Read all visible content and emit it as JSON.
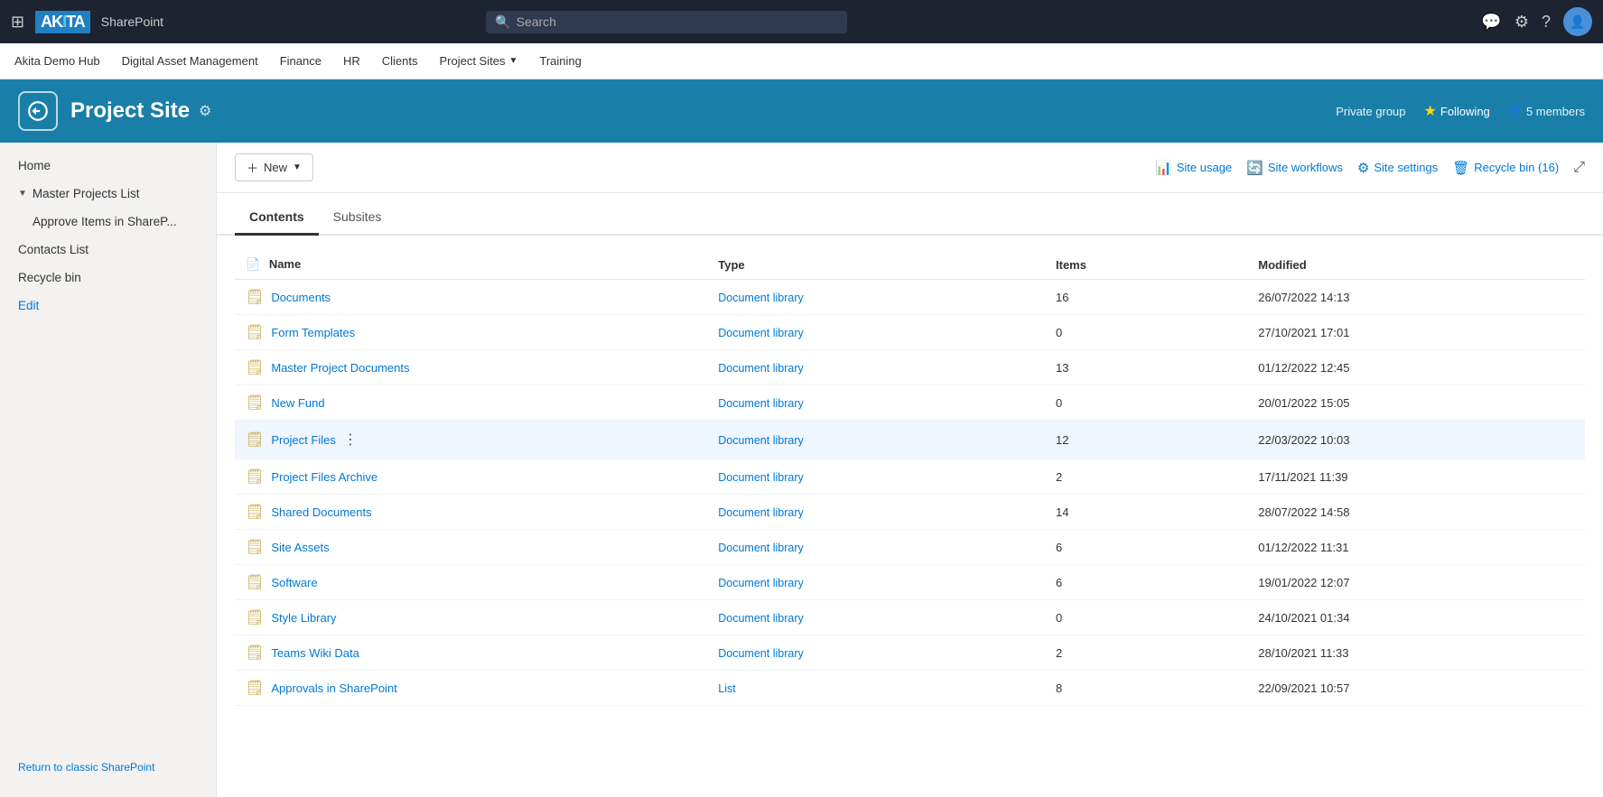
{
  "topNav": {
    "logoText": "AKITA",
    "appName": "SharePoint",
    "searchPlaceholder": "Search",
    "gridIconLabel": "⊞",
    "icons": {
      "message": "💬",
      "settings": "⚙",
      "help": "?",
      "avatar": "👤"
    }
  },
  "siteNav": {
    "items": [
      {
        "label": "Akita Demo Hub"
      },
      {
        "label": "Digital Asset Management"
      },
      {
        "label": "Finance"
      },
      {
        "label": "HR"
      },
      {
        "label": "Clients"
      },
      {
        "label": "Project Sites",
        "hasArrow": true
      },
      {
        "label": "Training"
      }
    ]
  },
  "siteHeader": {
    "title": "Project Site",
    "privateGroup": "Private group",
    "following": "Following",
    "members": "5 members"
  },
  "sidebar": {
    "homeLabel": "Home",
    "masterProjectsLabel": "Master Projects List",
    "approveLabel": "Approve Items in ShareP...",
    "contactsLabel": "Contacts List",
    "recycleBinLabel": "Recycle bin",
    "editLabel": "Edit",
    "returnLabel": "Return to classic SharePoint"
  },
  "toolbar": {
    "newLabel": "New",
    "siteUsage": "Site usage",
    "siteWorkflows": "Site workflows",
    "siteSettings": "Site settings",
    "recycleBin": "Recycle bin (16)"
  },
  "tabs": {
    "contents": "Contents",
    "subsites": "Subsites"
  },
  "table": {
    "columns": [
      "Name",
      "Type",
      "Items",
      "Modified"
    ],
    "rows": [
      {
        "name": "Documents",
        "type": "Document library",
        "items": "16",
        "modified": "26/07/2022 14:13",
        "highlighted": false
      },
      {
        "name": "Form Templates",
        "type": "Document library",
        "items": "0",
        "modified": "27/10/2021 17:01",
        "highlighted": false
      },
      {
        "name": "Master Project Documents",
        "type": "Document library",
        "items": "13",
        "modified": "01/12/2022 12:45",
        "highlighted": false
      },
      {
        "name": "New Fund",
        "type": "Document library",
        "items": "0",
        "modified": "20/01/2022 15:05",
        "highlighted": false
      },
      {
        "name": "Project Files",
        "type": "Document library",
        "items": "12",
        "modified": "22/03/2022 10:03",
        "highlighted": true
      },
      {
        "name": "Project Files Archive",
        "type": "Document library",
        "items": "2",
        "modified": "17/11/2021 11:39",
        "highlighted": false
      },
      {
        "name": "Shared Documents",
        "type": "Document library",
        "items": "14",
        "modified": "28/07/2022 14:58",
        "highlighted": false
      },
      {
        "name": "Site Assets",
        "type": "Document library",
        "items": "6",
        "modified": "01/12/2022 11:31",
        "highlighted": false
      },
      {
        "name": "Software",
        "type": "Document library",
        "items": "6",
        "modified": "19/01/2022 12:07",
        "highlighted": false
      },
      {
        "name": "Style Library",
        "type": "Document library",
        "items": "0",
        "modified": "24/10/2021 01:34",
        "highlighted": false
      },
      {
        "name": "Teams Wiki Data",
        "type": "Document library",
        "items": "2",
        "modified": "28/10/2021 11:33",
        "highlighted": false
      },
      {
        "name": "Approvals in SharePoint",
        "type": "List",
        "items": "8",
        "modified": "22/09/2021 10:57",
        "highlighted": false
      }
    ]
  }
}
